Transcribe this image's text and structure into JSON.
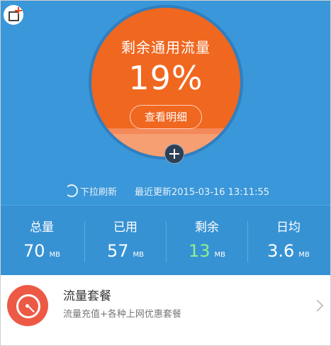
{
  "gauge": {
    "title": "剩余通用流量",
    "percent_text": "19%",
    "remaining_fraction": 0.19,
    "details_label": "查看明细",
    "colors": {
      "circle": "#f0671f",
      "fill": "#f59f73",
      "ring": "#2f7fc0"
    }
  },
  "refresh": {
    "pull_label": "下拉刷新",
    "updated_label": "最近更新2015-03-16 13:11:55"
  },
  "stats": [
    {
      "label": "总量",
      "value": "70",
      "unit": "MB",
      "color": "#ffffff"
    },
    {
      "label": "已用",
      "value": "57",
      "unit": "MB",
      "color": "#ffffff"
    },
    {
      "label": "剩余",
      "value": "13",
      "unit": "MB",
      "color": "#8ef08e"
    },
    {
      "label": "日均",
      "value": "3.6",
      "unit": "MB",
      "color": "#ffffff"
    }
  ],
  "package": {
    "title": "流量套餐",
    "subtitle": "流量充值+各种上网优惠套餐",
    "icon": "stopwatch-icon",
    "icon_color": "#ec5a45"
  },
  "theme": {
    "primary": "#3a97d9",
    "accent": "#f0671f"
  },
  "icons": {
    "corner": "add-widget-icon",
    "gauge_add": "plus-circle-icon",
    "refresh": "refresh-icon",
    "chevron": "chevron-right-icon"
  }
}
